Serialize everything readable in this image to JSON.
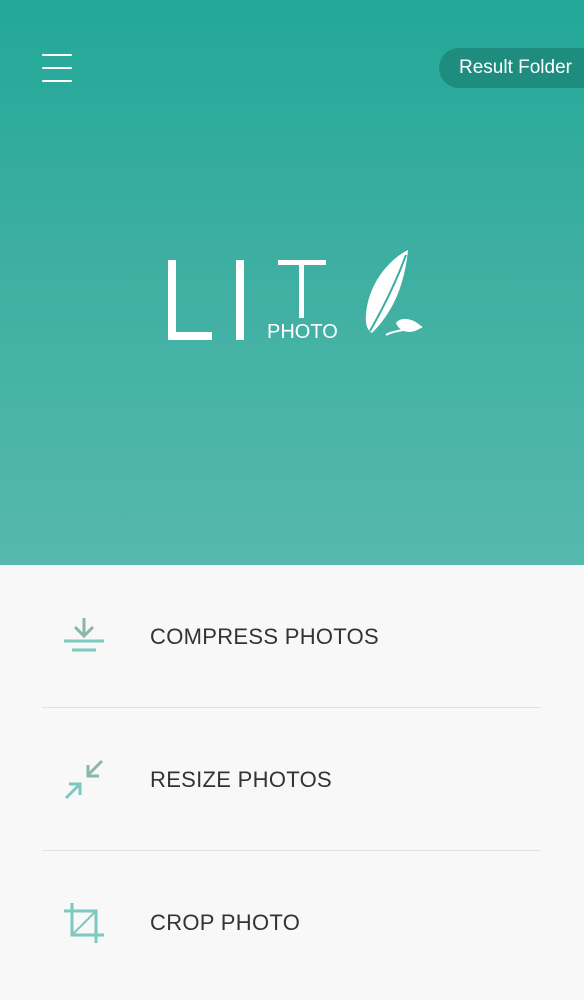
{
  "header": {
    "menu_icon": "hamburger-menu-icon",
    "result_folder_label": "Result Folder"
  },
  "logo": {
    "main_text": "LIT",
    "sub_text": "PHOTO",
    "icon": "feather-leaf-icon"
  },
  "menu": {
    "items": [
      {
        "label": "COMPRESS PHOTOS",
        "icon": "compress-icon"
      },
      {
        "label": "RESIZE PHOTOS",
        "icon": "resize-icon"
      },
      {
        "label": "CROP PHOTO",
        "icon": "crop-icon"
      }
    ]
  },
  "colors": {
    "hero_top": "#22a898",
    "hero_bottom": "#56b8ae",
    "result_folder_bg": "#1f8c80",
    "icon_accent": "#7cc9c0",
    "icon_accent_dark": "#8ab8a8"
  }
}
